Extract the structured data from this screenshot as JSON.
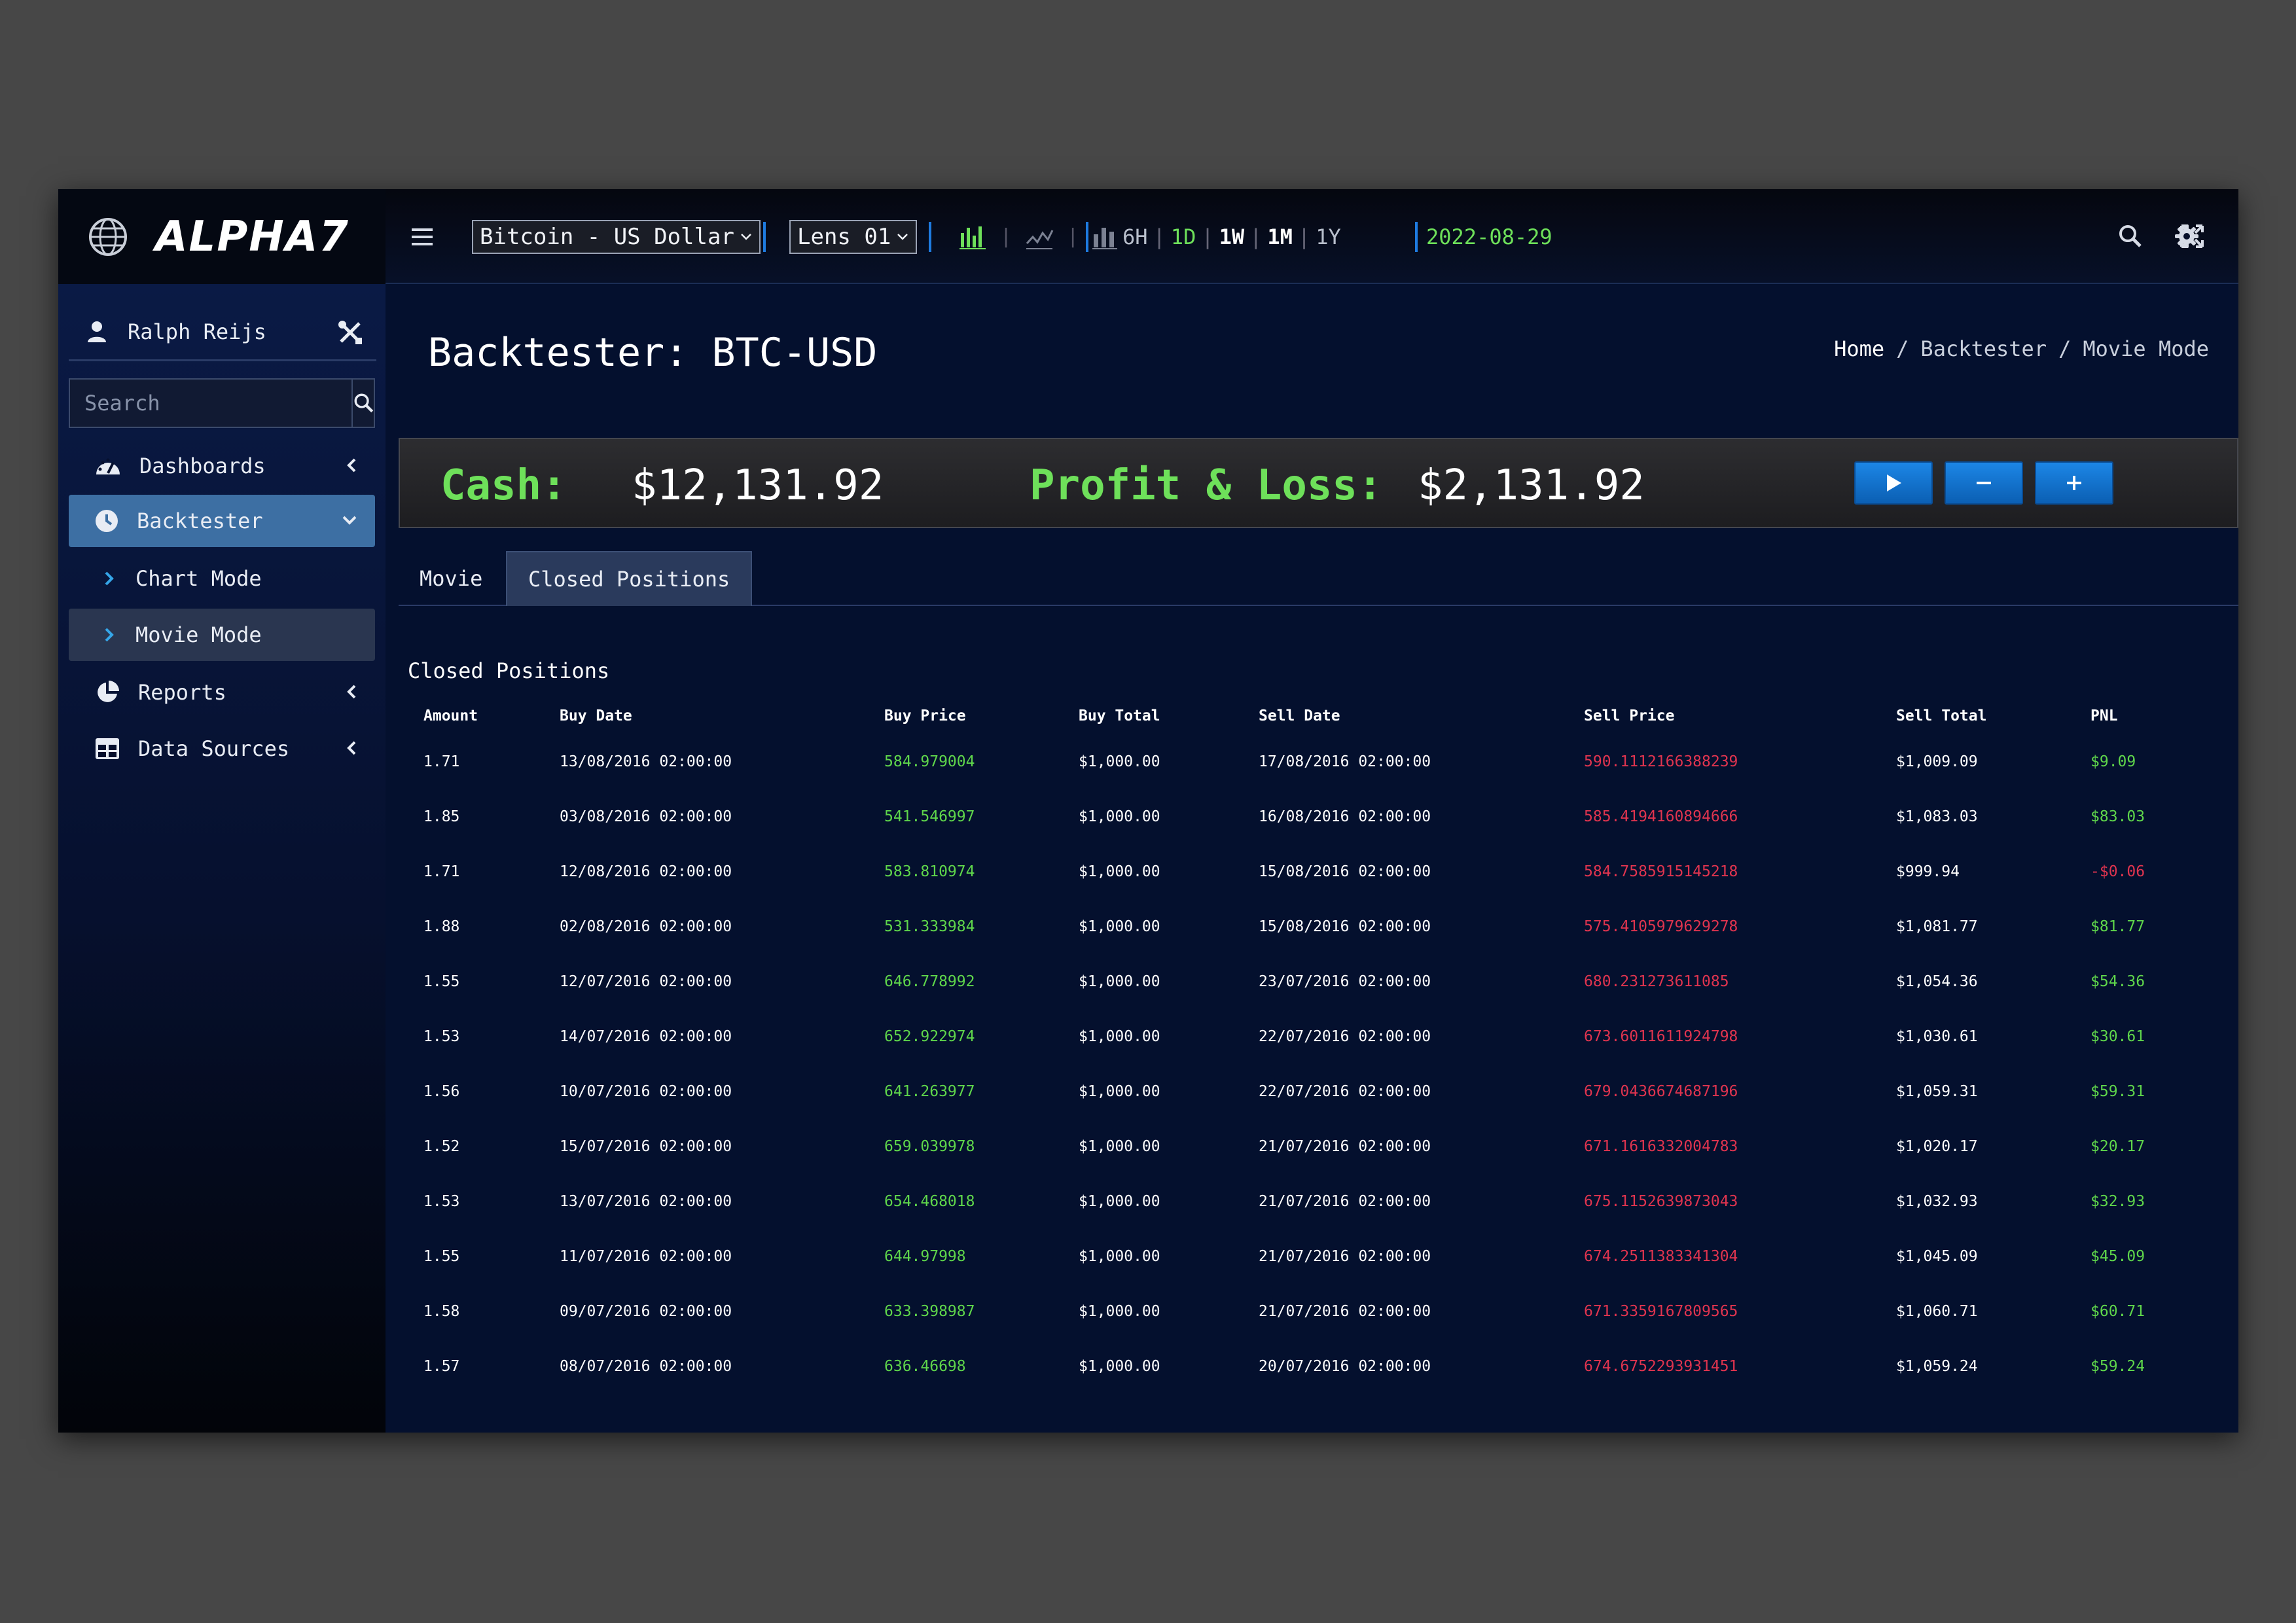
{
  "app": {
    "logo_text": "ALPHA7",
    "accent_color": "#1e7be0",
    "positive_color": "#5fd64b",
    "negative_color": "#e0344f"
  },
  "topbar": {
    "asset_select": "Bitcoin - US Dollar",
    "lens_select": "Lens 01",
    "chart_type_icons": [
      "candlestick-chart-icon",
      "line-chart-icon",
      "bar-chart-icon"
    ],
    "timeframes": [
      "6H",
      "1D",
      "1W",
      "1M",
      "1Y"
    ],
    "current_date": "2022-08-29",
    "right_icons": [
      "search-icon",
      "fullscreen-icon",
      "gear-icon"
    ]
  },
  "sidebar": {
    "user_name": "Ralph Reijs",
    "search_placeholder": "Search",
    "items": [
      {
        "label": "Dashboards",
        "icon": "dashboard-gauge-icon"
      },
      {
        "label": "Backtester",
        "icon": "clock-icon"
      },
      {
        "label": "Chart Mode",
        "icon": "chevron-right-icon"
      },
      {
        "label": "Movie Mode",
        "icon": "chevron-right-icon"
      },
      {
        "label": "Reports",
        "icon": "pie-chart-icon"
      },
      {
        "label": "Data Sources",
        "icon": "table-icon"
      }
    ]
  },
  "main": {
    "title": "Backtester: BTC-USD",
    "breadcrumb": {
      "home": "Home",
      "sep": "/",
      "section": "Backtester",
      "page": "Movie Mode"
    },
    "stats": {
      "cash_label": "Cash:",
      "cash_value": "$12,131.92",
      "pnl_label": "Profit & Loss:",
      "pnl_value": "$2,131.92"
    },
    "controls": [
      "play-icon",
      "minus-icon",
      "plus-icon"
    ],
    "tabs": [
      "Movie",
      "Closed Positions"
    ],
    "section_title": "Closed Positions",
    "table": {
      "headers": [
        "Amount",
        "Buy Date",
        "Buy Price",
        "Buy Total",
        "Sell Date",
        "Sell Price",
        "Sell Total",
        "PNL"
      ],
      "rows": [
        [
          "1.71",
          "13/08/2016 02:00:00",
          "584.979004",
          "$1,000.00",
          "17/08/2016 02:00:00",
          "590.1112166388239",
          "$1,009.09",
          "$9.09"
        ],
        [
          "1.85",
          "03/08/2016 02:00:00",
          "541.546997",
          "$1,000.00",
          "16/08/2016 02:00:00",
          "585.4194160894666",
          "$1,083.03",
          "$83.03"
        ],
        [
          "1.71",
          "12/08/2016 02:00:00",
          "583.810974",
          "$1,000.00",
          "15/08/2016 02:00:00",
          "584.7585915145218",
          "$999.94",
          "-$0.06"
        ],
        [
          "1.88",
          "02/08/2016 02:00:00",
          "531.333984",
          "$1,000.00",
          "15/08/2016 02:00:00",
          "575.4105979629278",
          "$1,081.77",
          "$81.77"
        ],
        [
          "1.55",
          "12/07/2016 02:00:00",
          "646.778992",
          "$1,000.00",
          "23/07/2016 02:00:00",
          "680.231273611085",
          "$1,054.36",
          "$54.36"
        ],
        [
          "1.53",
          "14/07/2016 02:00:00",
          "652.922974",
          "$1,000.00",
          "22/07/2016 02:00:00",
          "673.6011611924798",
          "$1,030.61",
          "$30.61"
        ],
        [
          "1.56",
          "10/07/2016 02:00:00",
          "641.263977",
          "$1,000.00",
          "22/07/2016 02:00:00",
          "679.0436674687196",
          "$1,059.31",
          "$59.31"
        ],
        [
          "1.52",
          "15/07/2016 02:00:00",
          "659.039978",
          "$1,000.00",
          "21/07/2016 02:00:00",
          "671.1616332004783",
          "$1,020.17",
          "$20.17"
        ],
        [
          "1.53",
          "13/07/2016 02:00:00",
          "654.468018",
          "$1,000.00",
          "21/07/2016 02:00:00",
          "675.1152639873043",
          "$1,032.93",
          "$32.93"
        ],
        [
          "1.55",
          "11/07/2016 02:00:00",
          "644.97998",
          "$1,000.00",
          "21/07/2016 02:00:00",
          "674.2511383341304",
          "$1,045.09",
          "$45.09"
        ],
        [
          "1.58",
          "09/07/2016 02:00:00",
          "633.398987",
          "$1,000.00",
          "21/07/2016 02:00:00",
          "671.3359167809565",
          "$1,060.71",
          "$60.71"
        ],
        [
          "1.57",
          "08/07/2016 02:00:00",
          "636.46698",
          "$1,000.00",
          "20/07/2016 02:00:00",
          "674.6752293931451",
          "$1,059.24",
          "$59.24"
        ]
      ]
    }
  }
}
